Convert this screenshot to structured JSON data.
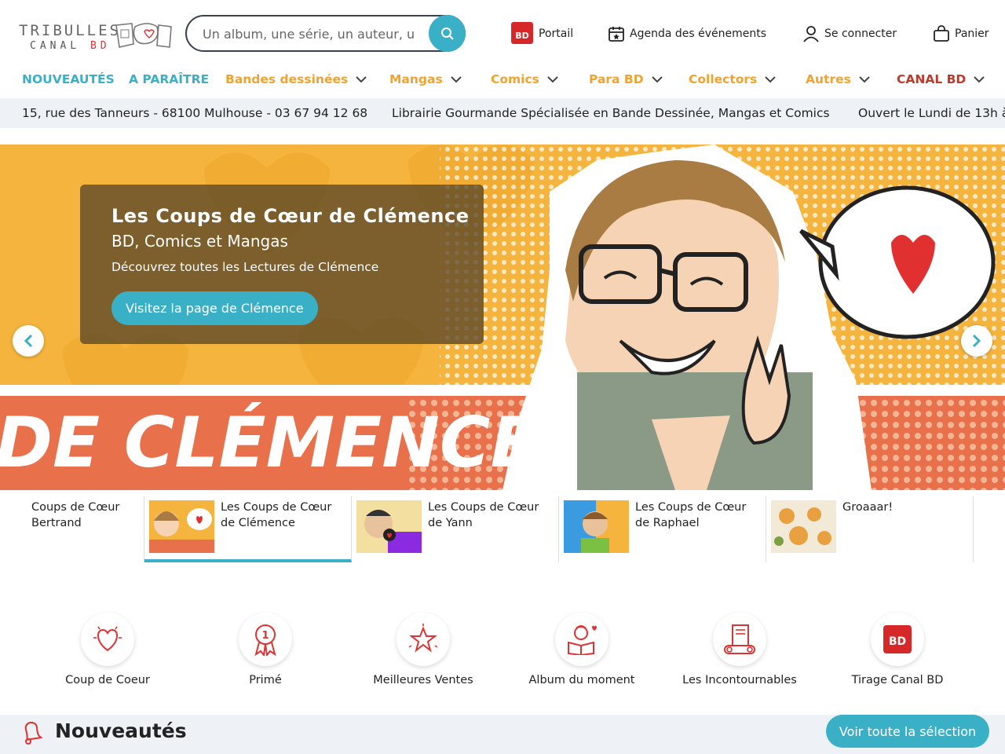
{
  "logo": {
    "line1": "TRIBULLES",
    "line2a": "CANAL",
    "line2b": "BD"
  },
  "search": {
    "placeholder": "Un album, une série, un auteur, u..."
  },
  "header_links": {
    "portail": "Portail",
    "agenda": "Agenda des événements",
    "login": "Se connecter",
    "cart": "Panier"
  },
  "nav": {
    "nouveautes": "NOUVEAUTÉS",
    "a_paraitre": "A PARAÎTRE",
    "bd": "Bandes dessinées",
    "mangas": "Mangas",
    "comics": "Comics",
    "para": "Para BD",
    "collectors": "Collectors",
    "autres": "Autres",
    "canal": "CANAL BD"
  },
  "ticker": {
    "address": "15, rue des Tanneurs - 68100 Mulhouse - 03 67 94 12 68",
    "tagline": "Librairie Gourmande Spécialisée en Bande Dessinée, Mangas et Comics",
    "hours": "Ouvert le Lundi de 13h à"
  },
  "hero": {
    "title": "Les Coups de Cœur de Clémence",
    "subtitle": "BD, Comics et Mangas",
    "text": "Découvrez toutes les Lectures de Clémence",
    "button": "Visitez la page de Clémence",
    "banner_text": "DE CLÉMENCE"
  },
  "thumbs": [
    {
      "line1": "Coups de Cœur",
      "line2": "Bertrand"
    },
    {
      "line1": "Les Coups de Cœur",
      "line2": "de Clémence"
    },
    {
      "line1": "Les Coups de Cœur",
      "line2": "de Yann"
    },
    {
      "line1": "Les Coups de Cœur",
      "line2": "de Raphael"
    },
    {
      "line1": "Groaaar!",
      "line2": ""
    }
  ],
  "categories": [
    {
      "label": "Coup de Coeur",
      "icon": "heart-icon"
    },
    {
      "label": "Primé",
      "icon": "award-icon"
    },
    {
      "label": "Meilleures Ventes",
      "icon": "star-icon"
    },
    {
      "label": "Album du moment",
      "icon": "reader-icon"
    },
    {
      "label": "Les Incontournables",
      "icon": "book-tape-icon"
    },
    {
      "label": "Tirage Canal BD",
      "icon": "canal-bd-badge-icon"
    }
  ],
  "news": {
    "title": "Nouveautés",
    "button": "Voir toute la sélection"
  },
  "colors": {
    "accent": "#3ab0c6",
    "gold": "#f0a32e",
    "red": "#c0392b"
  }
}
